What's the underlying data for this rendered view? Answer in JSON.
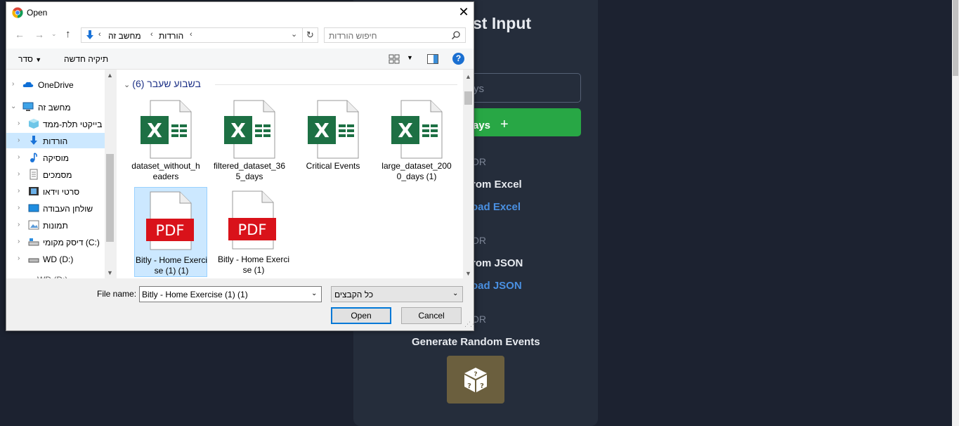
{
  "app": {
    "title_partial": "st Input",
    "days_placeholder_partial": "ys",
    "add_button_partial": "ays",
    "or_label": "OR",
    "from_excel_partial": "rom Excel",
    "upload_excel_partial": "oad Excel",
    "from_json_partial": "rom JSON",
    "upload_json_partial": "oad JSON",
    "generate_random_label": "Generate Random Events",
    "dice_icon": "dice-icon",
    "colors": {
      "background": "#1c2230",
      "panel": "#252d3b",
      "add_button": "#28a745",
      "link": "#4a90e2",
      "dice_button": "#6b5f3e"
    }
  },
  "dialog": {
    "title": "Open",
    "address": {
      "crumbs": [
        "מחשב זה",
        "הורדות"
      ]
    },
    "search_placeholder": "חיפוש הורדות",
    "toolbar": {
      "organize": "סדר",
      "new_folder": "תיקיה חדשה"
    },
    "nav_items": [
      {
        "label": "OneDrive",
        "icon": "onedrive-icon"
      },
      {
        "label": "מחשב זה",
        "icon": "this-pc-icon"
      },
      {
        "label": "בייקטי תלת-ממד",
        "icon": "3d-objects-icon"
      },
      {
        "label": "הורדות",
        "icon": "downloads-icon"
      },
      {
        "label": "מוסיקה",
        "icon": "music-icon"
      },
      {
        "label": "מסמכים",
        "icon": "documents-icon"
      },
      {
        "label": "סרטי וידאו",
        "icon": "videos-icon"
      },
      {
        "label": "שולחן העבודה",
        "icon": "desktop-icon"
      },
      {
        "label": "תמונות",
        "icon": "pictures-icon"
      },
      {
        "label": "דיסק מקומי (C:)",
        "icon": "local-disk-icon"
      },
      {
        "label": "WD (D:)",
        "icon": "drive-icon"
      }
    ],
    "group_header": "(6) בשבוע שעבר",
    "files": [
      {
        "name": "dataset_without_headers",
        "type": "excel"
      },
      {
        "name": "filtered_dataset_365_days",
        "type": "excel"
      },
      {
        "name": "Critical Events",
        "type": "excel"
      },
      {
        "name": "large_dataset_2000_days (1)",
        "type": "excel"
      },
      {
        "name": "Bitly - Home Exercise (1) (1)",
        "type": "pdf"
      },
      {
        "name": "Bitly - Home Exercise (1)",
        "type": "pdf"
      }
    ],
    "file_name_label": "File name:",
    "file_name_value": "Bitly - Home Exercise (1) (1)",
    "file_type_value": "כל הקבצים",
    "open_button": "Open",
    "cancel_button": "Cancel"
  }
}
